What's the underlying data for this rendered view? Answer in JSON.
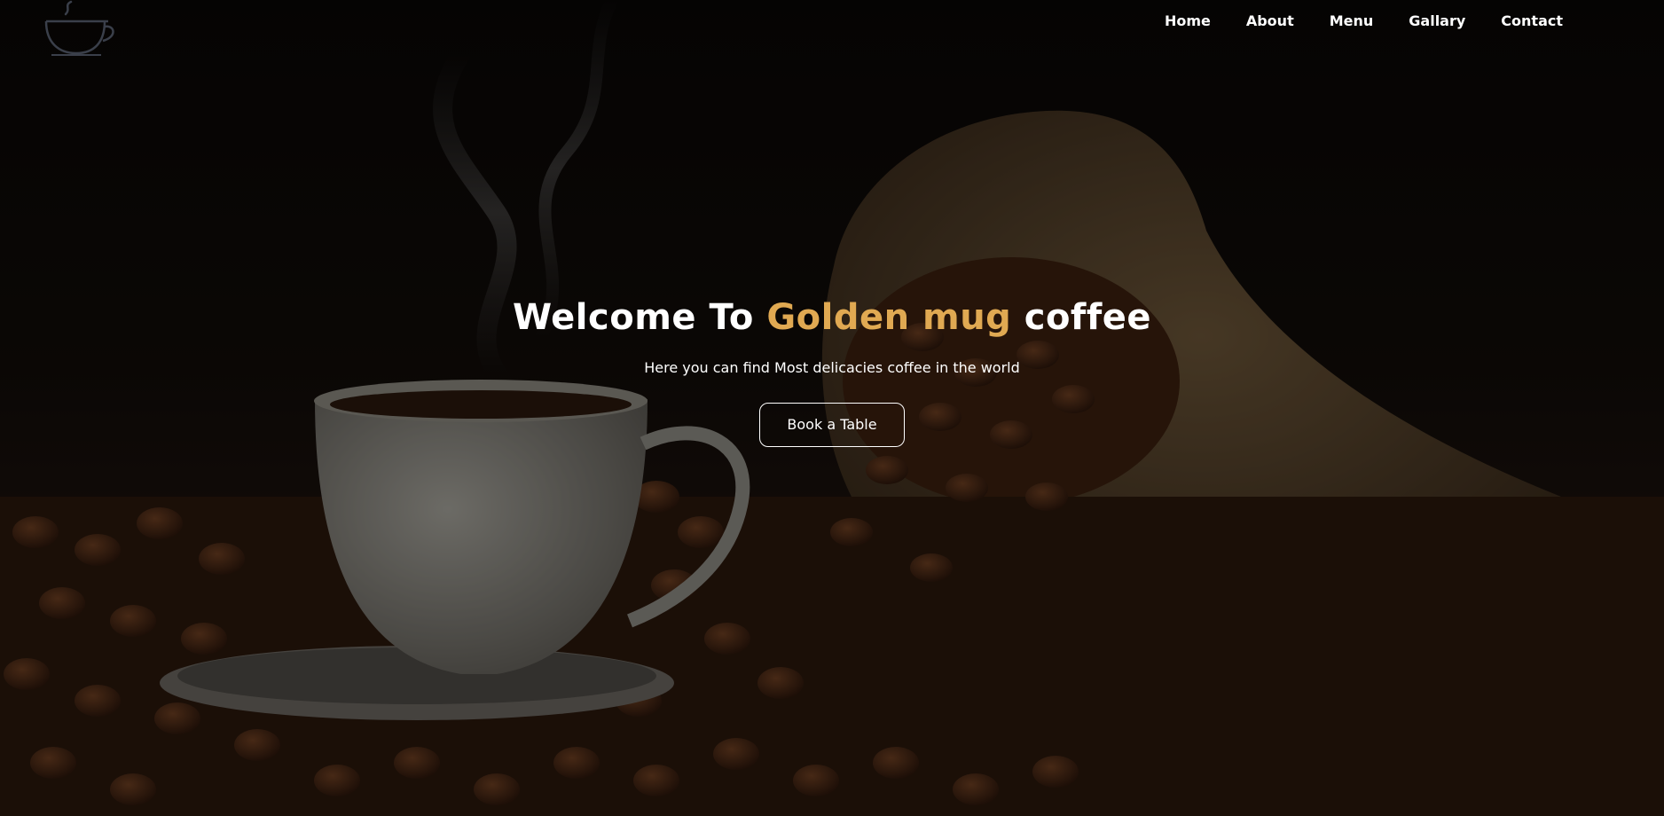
{
  "brand": {
    "logo_icon": "coffee-cup-icon"
  },
  "nav": {
    "items": [
      {
        "label": "Home"
      },
      {
        "label": "About"
      },
      {
        "label": "Menu"
      },
      {
        "label": "Gallary"
      },
      {
        "label": "Contact"
      }
    ]
  },
  "hero": {
    "title_prefix": "Welcome To ",
    "title_accent": "Golden mug",
    "title_suffix": " coffee",
    "subtitle": "Here you can find Most delicacies coffee in the world",
    "cta_label": "Book a Table",
    "accent_color": "#e0a952",
    "background_image": "coffee-cup-and-bean-sack-photo"
  }
}
